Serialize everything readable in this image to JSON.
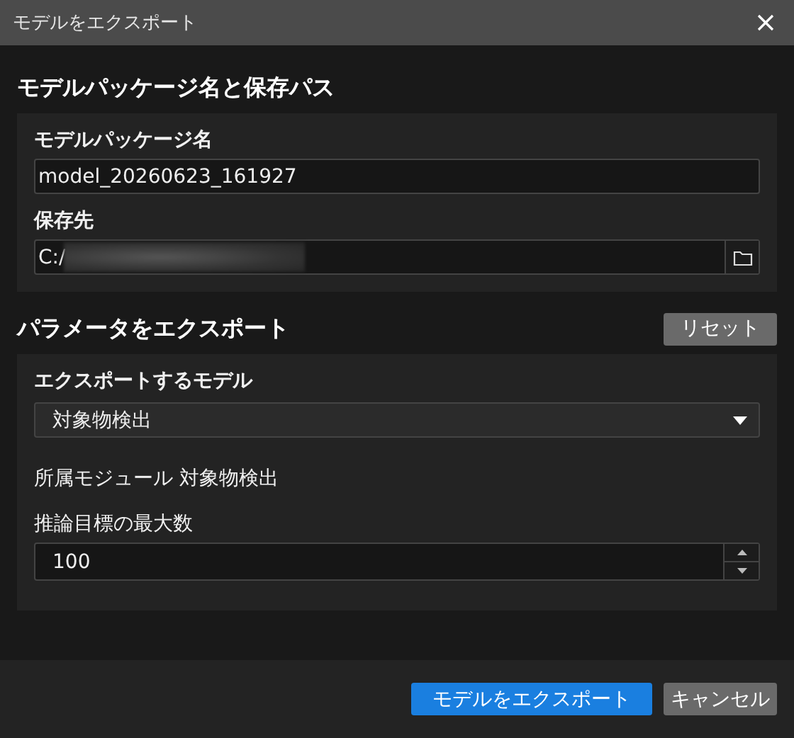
{
  "window": {
    "title": "モデルをエクスポート"
  },
  "package_section": {
    "heading": "モデルパッケージ名と保存パス",
    "name_label": "モデルパッケージ名",
    "name_value": "model_20260623_161927",
    "path_label": "保存先",
    "path_value": "C:/"
  },
  "params_section": {
    "heading": "パラメータをエクスポート",
    "reset_button": "リセット",
    "model_label": "エクスポートするモデル",
    "model_value": "対象物検出",
    "module_text": "所属モジュール 対象物検出",
    "max_label": "推論目標の最大数",
    "max_value": "100"
  },
  "buttons": [
    {
      "label": "モデルをエクスポート",
      "kind": "primary"
    },
    {
      "label": "キャンセル",
      "kind": "secondary"
    }
  ]
}
